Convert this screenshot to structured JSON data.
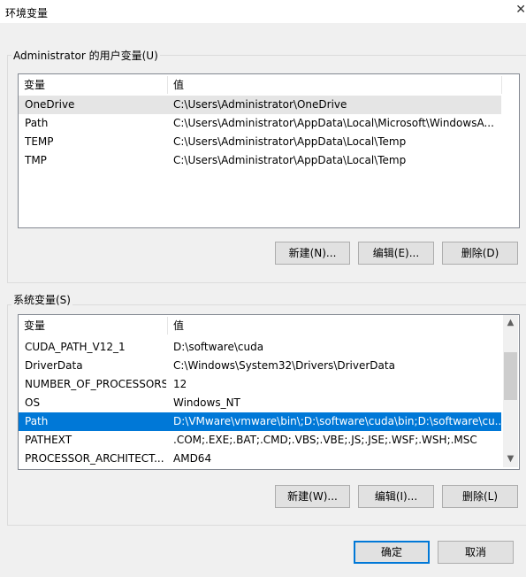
{
  "window": {
    "title": "环境变量"
  },
  "user_vars": {
    "group_label": "Administrator 的用户变量(U)",
    "col_name": "变量",
    "col_value": "值",
    "rows": [
      {
        "name": "OneDrive",
        "value": "C:\\Users\\Administrator\\OneDrive"
      },
      {
        "name": "Path",
        "value": "C:\\Users\\Administrator\\AppData\\Local\\Microsoft\\WindowsA..."
      },
      {
        "name": "TEMP",
        "value": "C:\\Users\\Administrator\\AppData\\Local\\Temp"
      },
      {
        "name": "TMP",
        "value": "C:\\Users\\Administrator\\AppData\\Local\\Temp"
      }
    ],
    "buttons": {
      "new": "新建(N)...",
      "edit": "编辑(E)...",
      "delete": "删除(D)"
    }
  },
  "system_vars": {
    "group_label": "系统变量(S)",
    "col_name": "变量",
    "col_value": "值",
    "rows": [
      {
        "name": "CUDA_PATH_V12_1",
        "value": "D:\\software\\cuda"
      },
      {
        "name": "DriverData",
        "value": "C:\\Windows\\System32\\Drivers\\DriverData"
      },
      {
        "name": "NUMBER_OF_PROCESSORS",
        "value": "12"
      },
      {
        "name": "OS",
        "value": "Windows_NT"
      },
      {
        "name": "Path",
        "value": "D:\\VMware\\vmware\\bin\\;D:\\software\\cuda\\bin;D:\\software\\cu..."
      },
      {
        "name": "PATHEXT",
        "value": ".COM;.EXE;.BAT;.CMD;.VBS;.VBE;.JS;.JSE;.WSF;.WSH;.MSC"
      },
      {
        "name": "PROCESSOR_ARCHITECT...",
        "value": "AMD64"
      }
    ],
    "selected_index": 4,
    "buttons": {
      "new": "新建(W)...",
      "edit": "编辑(I)...",
      "delete": "删除(L)"
    }
  },
  "dialog_buttons": {
    "ok": "确定",
    "cancel": "取消"
  },
  "colors": {
    "selection": "#0078d7",
    "hover_row": "#e5e5e5"
  }
}
